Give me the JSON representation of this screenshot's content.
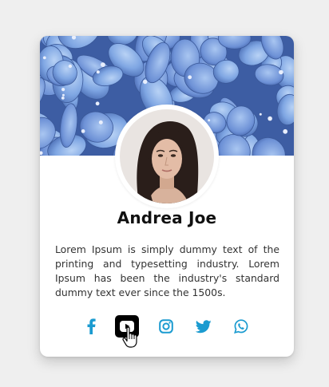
{
  "profile": {
    "name": "Andrea Joe",
    "bio": "Lorem Ipsum is simply dummy text of the printing and typesetting industry. Lorem Ipsum has been the industry's standard dummy text ever since the 1500s."
  },
  "socials": [
    {
      "network": "facebook",
      "icon": "facebook-icon"
    },
    {
      "network": "youtube",
      "icon": "youtube-icon",
      "state": "hovered"
    },
    {
      "network": "instagram",
      "icon": "instagram-icon"
    },
    {
      "network": "twitter",
      "icon": "twitter-icon"
    },
    {
      "network": "whatsapp",
      "icon": "whatsapp-icon"
    }
  ],
  "colors": {
    "background": "#efefef",
    "card": "#ffffff",
    "icon": "#1b9bd0",
    "active_icon_bg": "#000000",
    "name": "#111111",
    "text": "#333333"
  },
  "cover_image": "blue hydrangea flowers",
  "avatar_image": "portrait photo"
}
